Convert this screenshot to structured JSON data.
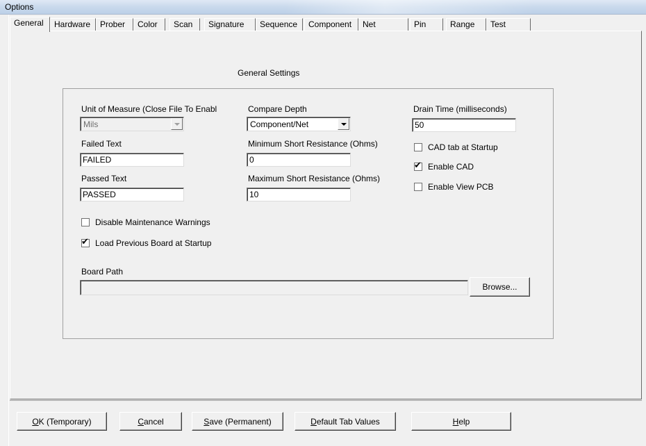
{
  "window": {
    "title": "Options"
  },
  "tabs": [
    {
      "label": "General",
      "active": true
    },
    {
      "label": "Hardware"
    },
    {
      "label": "Prober"
    },
    {
      "label": "Color"
    },
    {
      "label": "Scan"
    },
    {
      "label": "Signature"
    },
    {
      "label": "Sequence"
    },
    {
      "label": "Component"
    },
    {
      "label": "Net"
    },
    {
      "label": "Pin"
    },
    {
      "label": "Range"
    },
    {
      "label": "Test"
    }
  ],
  "panel": {
    "heading": "General Settings",
    "unit_of_measure": {
      "label": "Unit of Measure (Close File To Enabl",
      "value": "Mils",
      "disabled": true
    },
    "compare_depth": {
      "label": "Compare Depth",
      "value": "Component/Net"
    },
    "drain_time": {
      "label": "Drain Time (milliseconds)",
      "value": "50"
    },
    "failed_text": {
      "label": "Failed Text",
      "value": "FAILED"
    },
    "min_short": {
      "label": "Minimum Short Resistance (Ohms)",
      "value": "0"
    },
    "passed_text": {
      "label": "Passed Text",
      "value": "PASSED"
    },
    "max_short": {
      "label": "Maximum Short Resistance (Ohms)",
      "value": "10"
    },
    "checkboxes": {
      "cad_tab_startup": {
        "label": "CAD tab at Startup",
        "checked": false
      },
      "enable_cad": {
        "label": "Enable CAD",
        "checked": true
      },
      "enable_view_pcb": {
        "label": "Enable View PCB",
        "checked": false
      },
      "disable_maintenance": {
        "label": "Disable Maintenance Warnings",
        "checked": false
      },
      "load_previous_board": {
        "label": "Load Previous Board at Startup",
        "checked": true
      }
    },
    "board_path": {
      "label": "Board Path",
      "value": ""
    },
    "browse_label": "Browse..."
  },
  "buttons": {
    "ok": {
      "accel": "O",
      "rest": "K (Temporary)"
    },
    "cancel": {
      "accel": "C",
      "rest": "ancel"
    },
    "save": {
      "accel": "S",
      "rest": "ave (Permanent)"
    },
    "default": {
      "accel": "D",
      "rest": "efault Tab Values"
    },
    "help": {
      "accel": "H",
      "rest": "elp"
    }
  },
  "check_mark": "✔"
}
